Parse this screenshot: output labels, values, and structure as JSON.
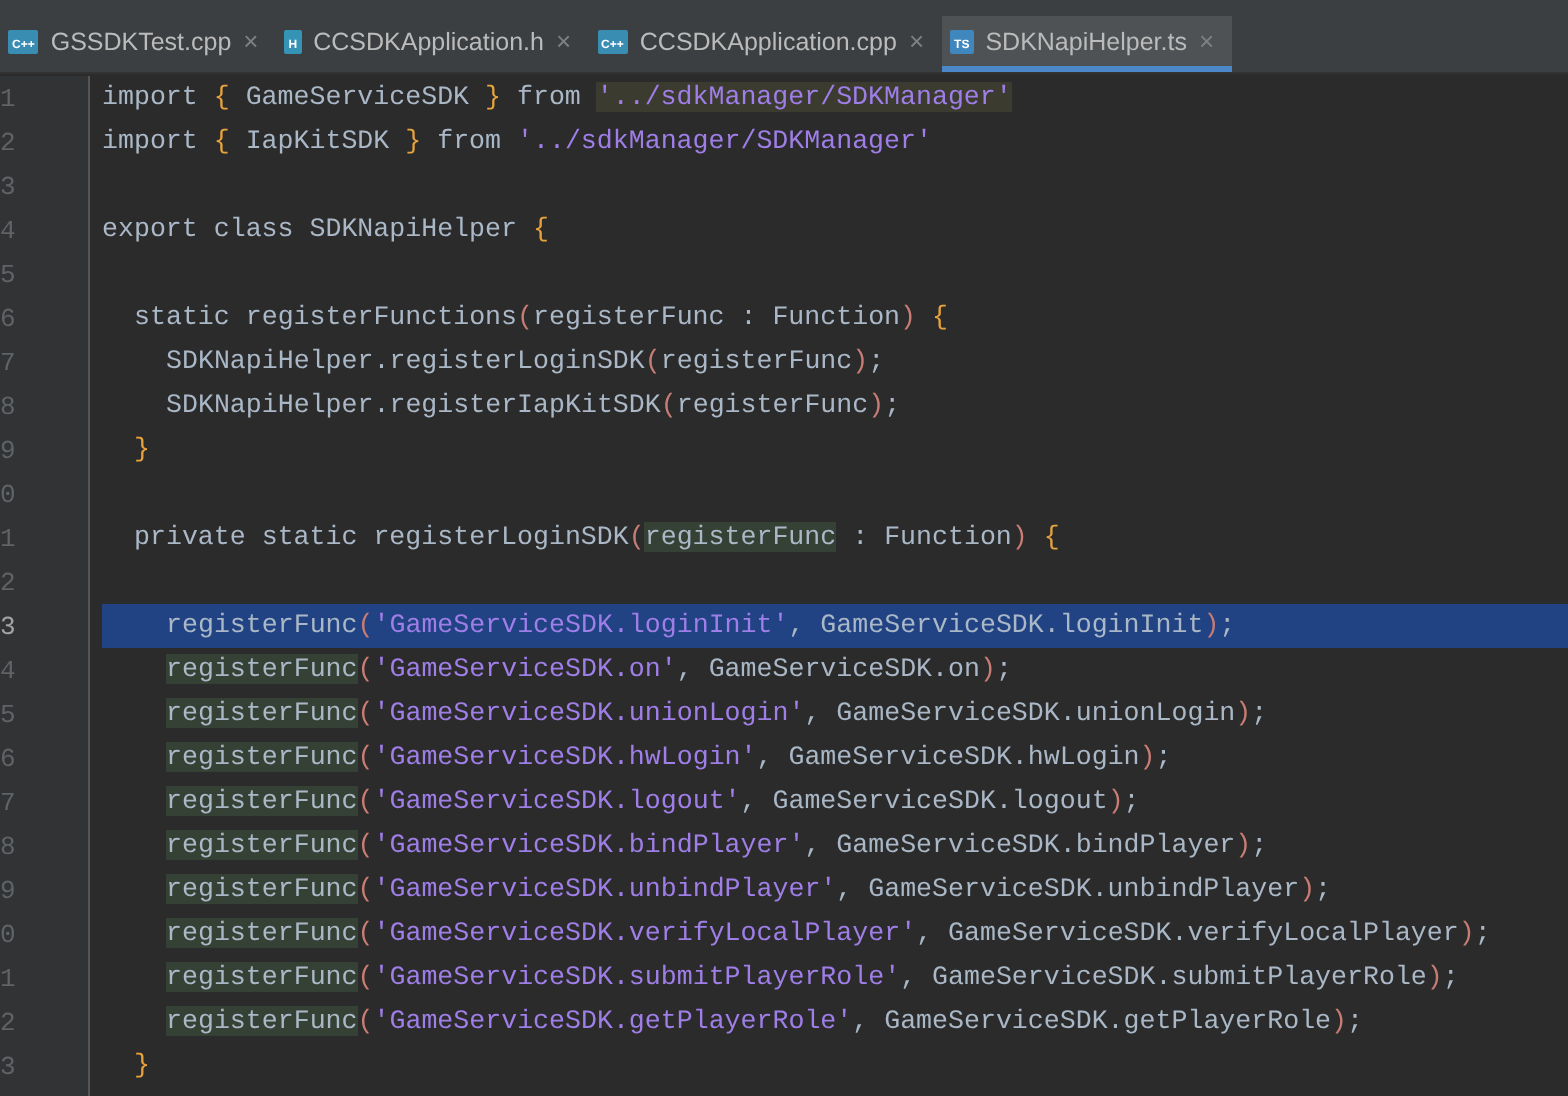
{
  "tabs": [
    {
      "kind": "cpp",
      "icon_label": "C++",
      "label": "GSSDKTest.cpp",
      "close": "×",
      "selected": false
    },
    {
      "kind": "h",
      "icon_label": "H",
      "label": "CCSDKApplication.h",
      "close": "×",
      "selected": false
    },
    {
      "kind": "cpp",
      "icon_label": "C++",
      "label": "CCSDKApplication.cpp",
      "close": "×",
      "selected": false
    },
    {
      "kind": "ts",
      "icon_label": "TS",
      "label": "SDKNapiHelper.ts",
      "close": "×",
      "selected": true
    }
  ],
  "editor": {
    "lines": [
      {
        "number": "1",
        "selected": false,
        "kind": "top",
        "tokens": [
          {
            "text": "import ",
            "kind": "plain"
          },
          {
            "text": "{",
            "kind": "brace"
          },
          {
            "text": " GameServiceSDK ",
            "kind": "plain"
          },
          {
            "text": "}",
            "kind": "brace"
          },
          {
            "text": " from ",
            "kind": "plain"
          },
          {
            "text": "'../sdkManager/SDKManager'",
            "kind": "string",
            "highlighted": true
          }
        ]
      },
      {
        "number": "2",
        "selected": false,
        "kind": "top",
        "tokens": [
          {
            "text": "import ",
            "kind": "plain"
          },
          {
            "text": "{",
            "kind": "brace"
          },
          {
            "text": " IapKitSDK ",
            "kind": "plain"
          },
          {
            "text": "}",
            "kind": "brace"
          },
          {
            "text": " from ",
            "kind": "plain"
          },
          {
            "text": "'../sdkManager/SDKManager'",
            "kind": "string"
          }
        ]
      },
      {
        "number": "3",
        "selected": false
      },
      {
        "number": "4",
        "selected": false,
        "kind": "top",
        "tokens": [
          {
            "text": "export class SDKNapiHelper ",
            "kind": "plain"
          },
          {
            "text": "{",
            "kind": "brace"
          }
        ]
      },
      {
        "number": "5",
        "selected": false
      },
      {
        "number": "6",
        "selected": false,
        "kind": "member",
        "tokens": [
          {
            "text": "static registerFunctions",
            "kind": "plain"
          },
          {
            "text": "(",
            "kind": "paren"
          },
          {
            "text": "registerFunc : Function",
            "kind": "plain"
          },
          {
            "text": ")",
            "kind": "paren"
          },
          {
            "text": " {",
            "kind": "brace"
          }
        ]
      },
      {
        "number": "7",
        "selected": false,
        "kind": "body",
        "tokens": [
          {
            "text": "SDKNapiHelper.registerLoginSDK",
            "kind": "plain"
          },
          {
            "text": "(",
            "kind": "paren"
          },
          {
            "text": "registerFunc",
            "kind": "plain"
          },
          {
            "text": ")",
            "kind": "paren"
          },
          {
            "text": ";",
            "kind": "plain"
          }
        ]
      },
      {
        "number": "8",
        "selected": false,
        "kind": "body",
        "tokens": [
          {
            "text": "SDKNapiHelper.registerIapKitSDK",
            "kind": "plain"
          },
          {
            "text": "(",
            "kind": "paren"
          },
          {
            "text": "registerFunc",
            "kind": "plain"
          },
          {
            "text": ")",
            "kind": "paren"
          },
          {
            "text": ";",
            "kind": "plain"
          }
        ]
      },
      {
        "number": "9",
        "selected": false,
        "kind": "member",
        "tokens": [
          {
            "text": "}",
            "kind": "brace"
          }
        ]
      },
      {
        "number": "0",
        "selected": false
      },
      {
        "number": "1",
        "selected": false,
        "kind": "member",
        "tokens": [
          {
            "text": "private static registerLoginSDK",
            "kind": "plain"
          },
          {
            "text": "(",
            "kind": "paren"
          },
          {
            "text": "registerFunc",
            "kind": "plain",
            "highlighted": true
          },
          {
            "text": " : Function",
            "kind": "plain"
          },
          {
            "text": ")",
            "kind": "paren"
          },
          {
            "text": " {",
            "kind": "brace"
          }
        ]
      },
      {
        "number": "2",
        "selected": false
      },
      {
        "number": "3",
        "selected": true,
        "kind": "body",
        "tokens": [
          {
            "text": "registerFunc",
            "kind": "plain"
          },
          {
            "text": "(",
            "kind": "paren"
          },
          {
            "text": "'GameServiceSDK.loginInit'",
            "kind": "string"
          },
          {
            "text": ", GameServiceSDK.loginInit",
            "kind": "plain"
          },
          {
            "text": ")",
            "kind": "paren"
          },
          {
            "text": ";",
            "kind": "plain"
          }
        ]
      },
      {
        "number": "4",
        "selected": false,
        "kind": "body",
        "tokens": [
          {
            "text": "registerFunc",
            "kind": "plain",
            "highlighted": true
          },
          {
            "text": "(",
            "kind": "paren"
          },
          {
            "text": "'GameServiceSDK.on'",
            "kind": "string"
          },
          {
            "text": ", GameServiceSDK.on",
            "kind": "plain"
          },
          {
            "text": ")",
            "kind": "paren"
          },
          {
            "text": ";",
            "kind": "plain"
          }
        ]
      },
      {
        "number": "5",
        "selected": false,
        "kind": "body",
        "tokens": [
          {
            "text": "registerFunc",
            "kind": "plain",
            "highlighted": true
          },
          {
            "text": "(",
            "kind": "paren"
          },
          {
            "text": "'GameServiceSDK.unionLogin'",
            "kind": "string"
          },
          {
            "text": ", GameServiceSDK.unionLogin",
            "kind": "plain"
          },
          {
            "text": ")",
            "kind": "paren"
          },
          {
            "text": ";",
            "kind": "plain"
          }
        ]
      },
      {
        "number": "6",
        "selected": false,
        "kind": "body",
        "tokens": [
          {
            "text": "registerFunc",
            "kind": "plain",
            "highlighted": true
          },
          {
            "text": "(",
            "kind": "paren"
          },
          {
            "text": "'GameServiceSDK.hwLogin'",
            "kind": "string"
          },
          {
            "text": ", GameServiceSDK.hwLogin",
            "kind": "plain"
          },
          {
            "text": ")",
            "kind": "paren"
          },
          {
            "text": ";",
            "kind": "plain"
          }
        ]
      },
      {
        "number": "7",
        "selected": false,
        "kind": "body",
        "tokens": [
          {
            "text": "registerFunc",
            "kind": "plain",
            "highlighted": true
          },
          {
            "text": "(",
            "kind": "paren"
          },
          {
            "text": "'GameServiceSDK.logout'",
            "kind": "string"
          },
          {
            "text": ", GameServiceSDK.logout",
            "kind": "plain"
          },
          {
            "text": ")",
            "kind": "paren"
          },
          {
            "text": ";",
            "kind": "plain"
          }
        ]
      },
      {
        "number": "8",
        "selected": false,
        "kind": "body",
        "tokens": [
          {
            "text": "registerFunc",
            "kind": "plain",
            "highlighted": true
          },
          {
            "text": "(",
            "kind": "paren"
          },
          {
            "text": "'GameServiceSDK.bindPlayer'",
            "kind": "string"
          },
          {
            "text": ", GameServiceSDK.bindPlayer",
            "kind": "plain"
          },
          {
            "text": ")",
            "kind": "paren"
          },
          {
            "text": ";",
            "kind": "plain"
          }
        ]
      },
      {
        "number": "9",
        "selected": false,
        "kind": "body",
        "tokens": [
          {
            "text": "registerFunc",
            "kind": "plain",
            "highlighted": true
          },
          {
            "text": "(",
            "kind": "paren"
          },
          {
            "text": "'GameServiceSDK.unbindPlayer'",
            "kind": "string"
          },
          {
            "text": ", GameServiceSDK.unbindPlayer",
            "kind": "plain"
          },
          {
            "text": ")",
            "kind": "paren"
          },
          {
            "text": ";",
            "kind": "plain"
          }
        ]
      },
      {
        "number": "0",
        "selected": false,
        "kind": "body",
        "tokens": [
          {
            "text": "registerFunc",
            "kind": "plain",
            "highlighted": true
          },
          {
            "text": "(",
            "kind": "paren"
          },
          {
            "text": "'GameServiceSDK.verifyLocalPlayer'",
            "kind": "string"
          },
          {
            "text": ", GameServiceSDK.verifyLocalPlayer",
            "kind": "plain"
          },
          {
            "text": ")",
            "kind": "paren"
          },
          {
            "text": ";",
            "kind": "plain"
          }
        ]
      },
      {
        "number": "1",
        "selected": false,
        "kind": "body",
        "tokens": [
          {
            "text": "registerFunc",
            "kind": "plain",
            "highlighted": true
          },
          {
            "text": "(",
            "kind": "paren"
          },
          {
            "text": "'GameServiceSDK.submitPlayerRole'",
            "kind": "string"
          },
          {
            "text": ", GameServiceSDK.submitPlayerRole",
            "kind": "plain"
          },
          {
            "text": ")",
            "kind": "paren"
          },
          {
            "text": ";",
            "kind": "plain"
          }
        ]
      },
      {
        "number": "2",
        "selected": false,
        "kind": "body",
        "tokens": [
          {
            "text": "registerFunc",
            "kind": "plain",
            "highlighted": true
          },
          {
            "text": "(",
            "kind": "paren"
          },
          {
            "text": "'GameServiceSDK.getPlayerRole'",
            "kind": "string"
          },
          {
            "text": ", GameServiceSDK.getPlayerRole",
            "kind": "plain"
          },
          {
            "text": ")",
            "kind": "paren"
          },
          {
            "text": ";",
            "kind": "plain"
          }
        ]
      },
      {
        "number": "3",
        "selected": false,
        "kind": "member",
        "tokens": [
          {
            "text": "}",
            "kind": "brace"
          }
        ]
      }
    ]
  }
}
